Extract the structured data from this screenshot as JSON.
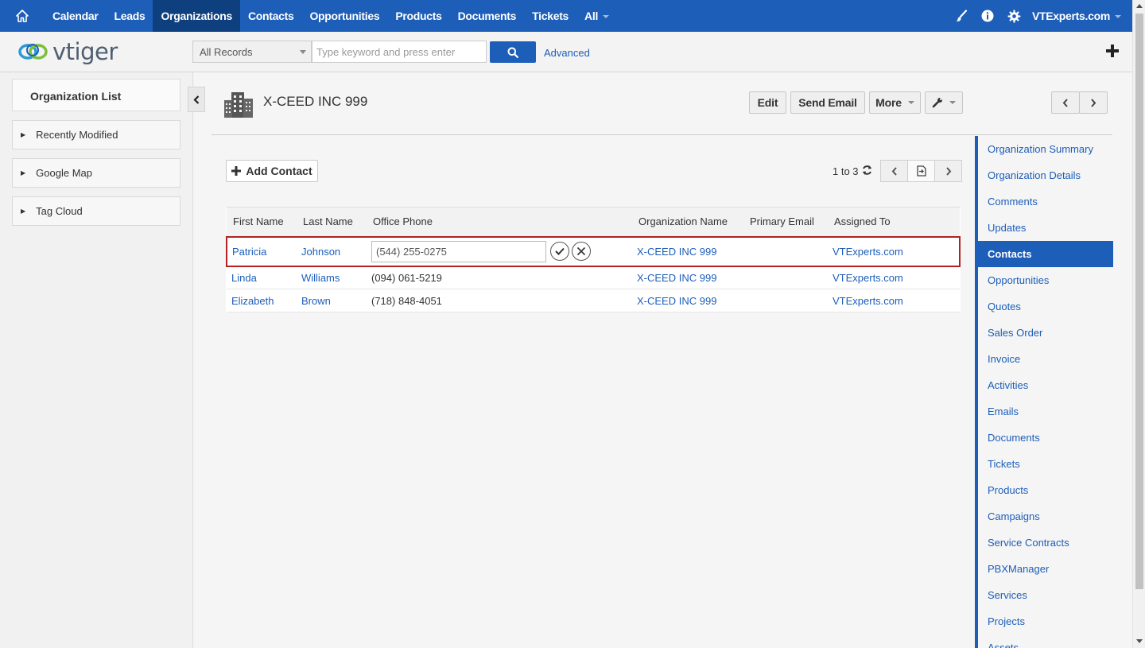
{
  "nav": {
    "items": [
      "Calendar",
      "Leads",
      "Organizations",
      "Contacts",
      "Opportunities",
      "Products",
      "Documents",
      "Tickets",
      "All"
    ],
    "active": "Organizations",
    "user": "VTExperts.com"
  },
  "logo": {
    "text": "vtiger"
  },
  "search": {
    "filter": "All Records",
    "placeholder": "Type keyword and press enter",
    "advanced_label": "Advanced"
  },
  "sidebar": {
    "title": "Organization List",
    "items": [
      {
        "label": "Recently Modified"
      },
      {
        "label": "Google Map"
      },
      {
        "label": "Tag Cloud"
      }
    ]
  },
  "record": {
    "title": "X-CEED INC 999",
    "buttons": {
      "edit": "Edit",
      "send_email": "Send Email",
      "more": "More"
    }
  },
  "contacts": {
    "add_label": "Add Contact",
    "range": "1 to 3",
    "columns": [
      "First Name",
      "Last Name",
      "Office Phone",
      "Organization Name",
      "Primary Email",
      "Assigned To"
    ],
    "rows": [
      {
        "first": "Patricia",
        "last": "Johnson",
        "phone": "(544) 255-0275",
        "org": "X-CEED INC 999",
        "email": "",
        "assigned": "VTExperts.com",
        "editing": true
      },
      {
        "first": "Linda",
        "last": "Williams",
        "phone": "(094) 061-5219",
        "org": "X-CEED INC 999",
        "email": "",
        "assigned": "VTExperts.com",
        "editing": false
      },
      {
        "first": "Elizabeth",
        "last": "Brown",
        "phone": "(718) 848-4051",
        "org": "X-CEED INC 999",
        "email": "",
        "assigned": "VTExperts.com",
        "editing": false
      }
    ]
  },
  "related": {
    "items": [
      "Organization Summary",
      "Organization Details",
      "Comments",
      "Updates",
      "Contacts",
      "Opportunities",
      "Quotes",
      "Sales Order",
      "Invoice",
      "Activities",
      "Emails",
      "Documents",
      "Tickets",
      "Products",
      "Campaigns",
      "Service Contracts",
      "PBXManager",
      "Services",
      "Projects",
      "Assets"
    ],
    "active": "Contacts"
  },
  "colors": {
    "brand": "#1d5eb9",
    "nav_active": "#0e3f7e",
    "edit_border": "#b22222"
  }
}
